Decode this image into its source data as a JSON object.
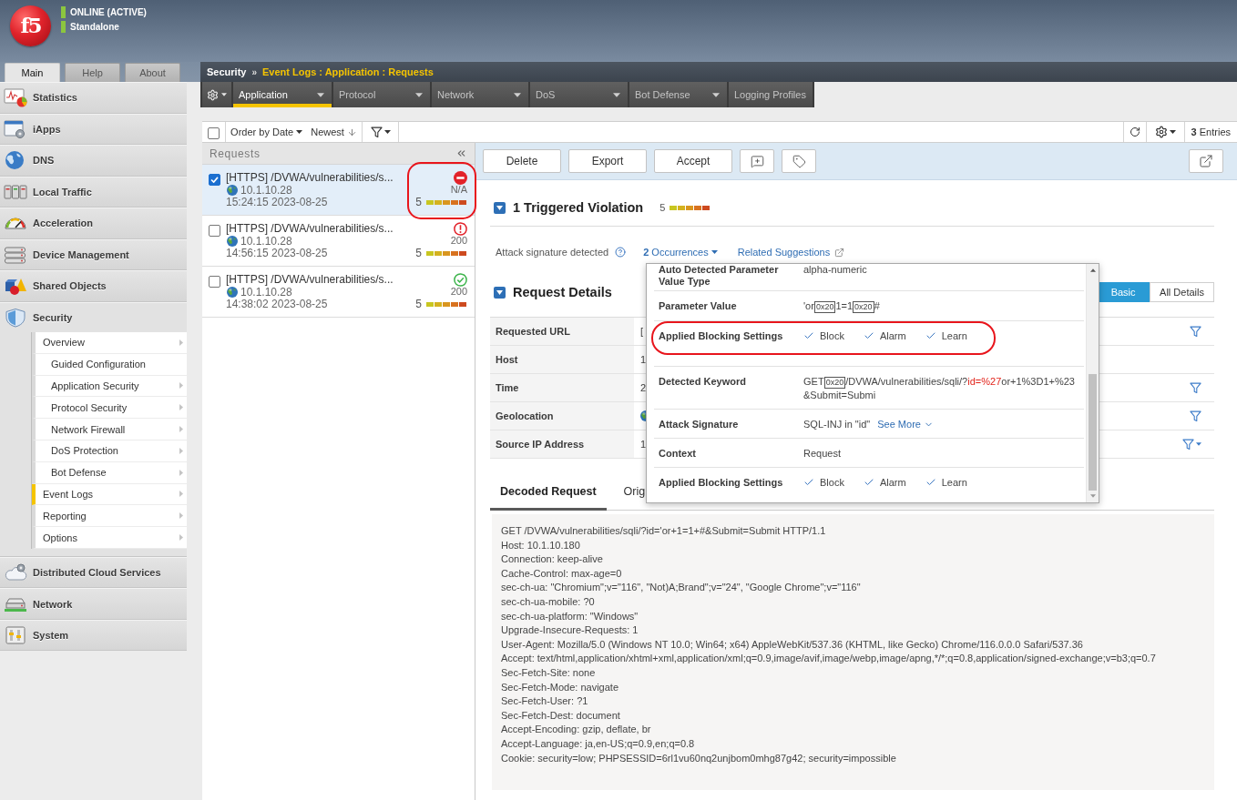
{
  "header": {
    "logo": "f5",
    "status": [
      "ONLINE (ACTIVE)",
      "Standalone"
    ]
  },
  "main_tabs": [
    {
      "label": "Main",
      "selected": true
    },
    {
      "label": "Help",
      "selected": false
    },
    {
      "label": "About",
      "selected": false
    }
  ],
  "sidebar": {
    "items": [
      {
        "label": "Statistics",
        "expanded": false
      },
      {
        "label": "iApps",
        "expanded": false
      },
      {
        "label": "DNS",
        "expanded": false
      },
      {
        "label": "Local Traffic",
        "expanded": false
      },
      {
        "label": "Acceleration",
        "expanded": false
      },
      {
        "label": "Device Management",
        "expanded": false
      },
      {
        "label": "Shared Objects",
        "expanded": false
      },
      {
        "label": "Security",
        "expanded": true,
        "children": [
          {
            "label": "Overview",
            "selected": false,
            "submenu": true,
            "children": [
              {
                "label": "Guided Configuration",
                "selected": false,
                "submenu": false
              },
              {
                "label": "Application Security",
                "selected": false,
                "submenu": true
              },
              {
                "label": "Protocol Security",
                "selected": false,
                "submenu": true
              },
              {
                "label": "Network Firewall",
                "selected": false,
                "submenu": true
              },
              {
                "label": "DoS Protection",
                "selected": false,
                "submenu": true
              },
              {
                "label": "Bot Defense",
                "selected": false,
                "submenu": true
              }
            ]
          },
          {
            "label": "Event Logs",
            "selected": true,
            "submenu": true
          },
          {
            "label": "Reporting",
            "selected": false,
            "submenu": true
          },
          {
            "label": "Options",
            "selected": false,
            "submenu": true
          }
        ]
      },
      {
        "label": "Distributed Cloud Services",
        "expanded": false
      },
      {
        "label": "Network",
        "expanded": false
      },
      {
        "label": "System",
        "expanded": false
      }
    ]
  },
  "breadcrumb": {
    "section": "Security",
    "separator": "»",
    "path": "Event Logs : Application : Requests"
  },
  "module_tabs": [
    {
      "label": "Application",
      "selected": true,
      "dropdown": true
    },
    {
      "label": "Protocol",
      "selected": false,
      "dropdown": true
    },
    {
      "label": "Network",
      "selected": false,
      "dropdown": true
    },
    {
      "label": "DoS",
      "selected": false,
      "dropdown": true
    },
    {
      "label": "Bot Defense",
      "selected": false,
      "dropdown": true
    },
    {
      "label": "Logging Profiles",
      "selected": false,
      "dropdown": false
    }
  ],
  "toolbar": {
    "select_all_checked": false,
    "sort": "Order by Date",
    "order": "Newest",
    "entries": "**3** Entries"
  },
  "requests": {
    "title": "Requests",
    "rows": [
      {
        "title": "[HTTPS] /DVWA/vulnerabilities/s...",
        "ip": "10.1.10.28",
        "time": "15:24:15 2023-08-25",
        "kind": "blocked",
        "code": "N/A",
        "severity": "5",
        "level": 1,
        "checked": true,
        "selected": true,
        "annotated": true
      },
      {
        "title": "[HTTPS] /DVWA/vulnerabilities/s...",
        "ip": "10.1.10.28",
        "time": "14:56:15 2023-08-25",
        "kind": "alerted",
        "code": "200",
        "severity": "5",
        "level": 1,
        "checked": false,
        "selected": false,
        "annotated": false
      },
      {
        "title": "[HTTPS] /DVWA/vulnerabilities/s...",
        "ip": "10.1.10.28",
        "time": "14:38:02 2023-08-25",
        "kind": "passed",
        "code": "200",
        "severity": "5",
        "level": 1,
        "checked": false,
        "selected": false,
        "annotated": false
      }
    ]
  },
  "actions": [
    "Delete",
    "Export",
    "Accept"
  ],
  "violations": {
    "title": "1 Triggered Violation",
    "expanded": true,
    "severity": "5",
    "level": 1,
    "items": [
      {
        "name": "Attack signature detected",
        "occurrences": "**2** Occurrences",
        "suggestions": "Related Suggestions"
      }
    ]
  },
  "occurrence_popup": {
    "rows": [
      {
        "label": "Auto Detected Parameter Value Type",
        "kind": "text",
        "value": "alpha-numeric",
        "annotated": false
      },
      {
        "label": "Parameter Value",
        "kind": "segments",
        "annotated": false,
        "segments": [
          {
            "kind": "text",
            "text": "'or"
          },
          {
            "kind": "space",
            "text": "0x20"
          },
          {
            "kind": "text",
            "text": "1=1"
          },
          {
            "kind": "space",
            "text": "0x20"
          },
          {
            "kind": "text",
            "text": "#"
          }
        ]
      },
      {
        "label": "Applied Blocking Settings",
        "kind": "checks",
        "annotated": true,
        "checks": [
          {
            "label": "Block",
            "checked": true
          },
          {
            "label": "Alarm",
            "checked": true
          },
          {
            "label": "Learn",
            "checked": true
          }
        ]
      },
      {
        "label": "Detected Keyword",
        "kind": "segments",
        "annotated": false,
        "segments": [
          {
            "kind": "text",
            "text": "GET"
          },
          {
            "kind": "space",
            "text": "0x20"
          },
          {
            "kind": "text",
            "text": "/DVWA/vulnerabilities/sqli/?"
          },
          {
            "kind": "match",
            "text": "id=%27"
          },
          {
            "kind": "text",
            "text": "or+1%3D1+%23"
          },
          {
            "kind": "text",
            "text": "&Submit=Submi"
          }
        ]
      },
      {
        "label": "Attack Signature",
        "kind": "link",
        "value": "SQL-INJ in \"id\"",
        "link": "See More",
        "annotated": false
      },
      {
        "label": "Context",
        "kind": "text",
        "value": "Request",
        "annotated": false
      },
      {
        "label": "Applied Blocking Settings",
        "kind": "checks",
        "annotated": false,
        "checks": [
          {
            "label": "Block",
            "checked": true
          },
          {
            "label": "Alarm",
            "checked": true
          },
          {
            "label": "Learn",
            "checked": true
          }
        ]
      }
    ]
  },
  "request_details": {
    "title": "Request Details",
    "expanded": true,
    "views": [
      {
        "label": "Basic",
        "selected": true
      },
      {
        "label": "All Details",
        "selected": false
      }
    ],
    "rows": [
      {
        "label": "Requested URL",
        "kind": "text",
        "value": "[",
        "filter": true,
        "filter_menu": false
      },
      {
        "label": "Host",
        "kind": "text",
        "value": "1",
        "filter": false,
        "filter_menu": false
      },
      {
        "label": "Time",
        "kind": "text",
        "value": "2",
        "filter": true,
        "filter_menu": false
      },
      {
        "label": "Geolocation",
        "kind": "location",
        "filter": true,
        "filter_menu": false
      },
      {
        "label": "Source IP Address",
        "kind": "text",
        "value": "1",
        "filter": true,
        "filter_menu": true
      }
    ]
  },
  "body_tabs": [
    {
      "label": "Decoded Request",
      "selected": true
    },
    {
      "label": "Orig",
      "selected": false
    }
  ],
  "request_text": [
    "GET /DVWA/vulnerabilities/sqli/?id='or+1=1+#&Submit=Submit HTTP/1.1",
    "Host: 10.1.10.180",
    "Connection: keep-alive",
    "Cache-Control: max-age=0",
    "sec-ch-ua: \"Chromium\";v=\"116\", \"Not)A;Brand\";v=\"24\", \"Google Chrome\";v=\"116\"",
    "sec-ch-ua-mobile: ?0",
    "sec-ch-ua-platform: \"Windows\"",
    "Upgrade-Insecure-Requests: 1",
    "User-Agent: Mozilla/5.0 (Windows NT 10.0; Win64; x64) AppleWebKit/537.36 (KHTML, like Gecko) Chrome/116.0.0.0 Safari/537.36",
    "Accept: text/html,application/xhtml+xml,application/xml;q=0.9,image/avif,image/webp,image/apng,*/*;q=0.8,application/signed-exchange;v=b3;q=0.7",
    "Sec-Fetch-Site: none",
    "Sec-Fetch-Mode: navigate",
    "Sec-Fetch-User: ?1",
    "Sec-Fetch-Dest: document",
    "Accept-Encoding: gzip, deflate, br",
    "Accept-Language: ja,en-US;q=0.9,en;q=0.8",
    "Cookie: security=low; PHPSESSID=6rl1vu60nq2unjbom0mhg87g42; security=impossible"
  ]
}
